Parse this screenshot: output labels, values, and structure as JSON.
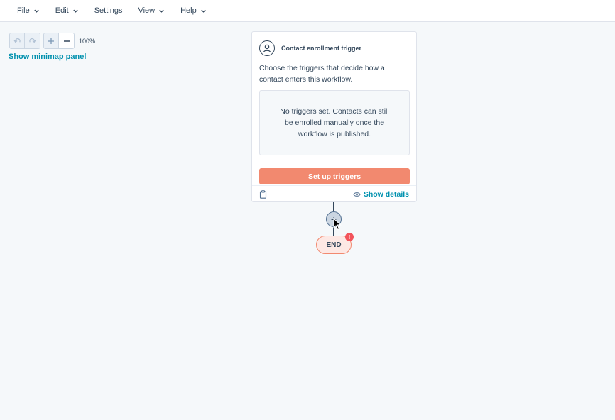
{
  "menubar": {
    "file": "File",
    "edit": "Edit",
    "settings": "Settings",
    "view": "View",
    "help": "Help"
  },
  "canvas": {
    "zoom_level": "100%",
    "minimap_link": "Show minimap panel"
  },
  "trigger_card": {
    "title": "Contact enrollment trigger",
    "description": "Choose the triggers that decide how a contact enters this workflow.",
    "empty_message": "No triggers set. Contacts can still be enrolled manually once the workflow is published.",
    "setup_button": "Set up triggers",
    "show_details": "Show details"
  },
  "flow": {
    "add_symbol": "+",
    "end_label": "END",
    "alert_badge": "!"
  },
  "colors": {
    "accent_link": "#0091ae",
    "primary_button": "#f2896f",
    "alert": "#f2545b",
    "text": "#33475b"
  }
}
